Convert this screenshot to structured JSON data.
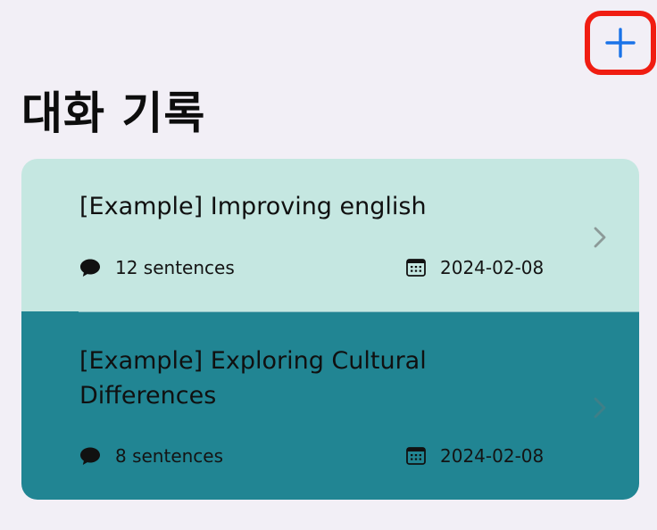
{
  "header": {
    "add_icon": "plus-icon",
    "title": "대화 기록"
  },
  "conversations": [
    {
      "title": "[Example] Improving english",
      "sentences": "12 sentences",
      "date": "2024-02-08",
      "background": "#c5e7e1"
    },
    {
      "title": "[Example] Exploring Cultural Differences",
      "sentences": "8 sentences",
      "date": "2024-02-08",
      "background": "#218593"
    }
  ],
  "colors": {
    "page_background": "#f2eff6",
    "accent": "#1a73e8",
    "highlight": "#f01d12"
  }
}
